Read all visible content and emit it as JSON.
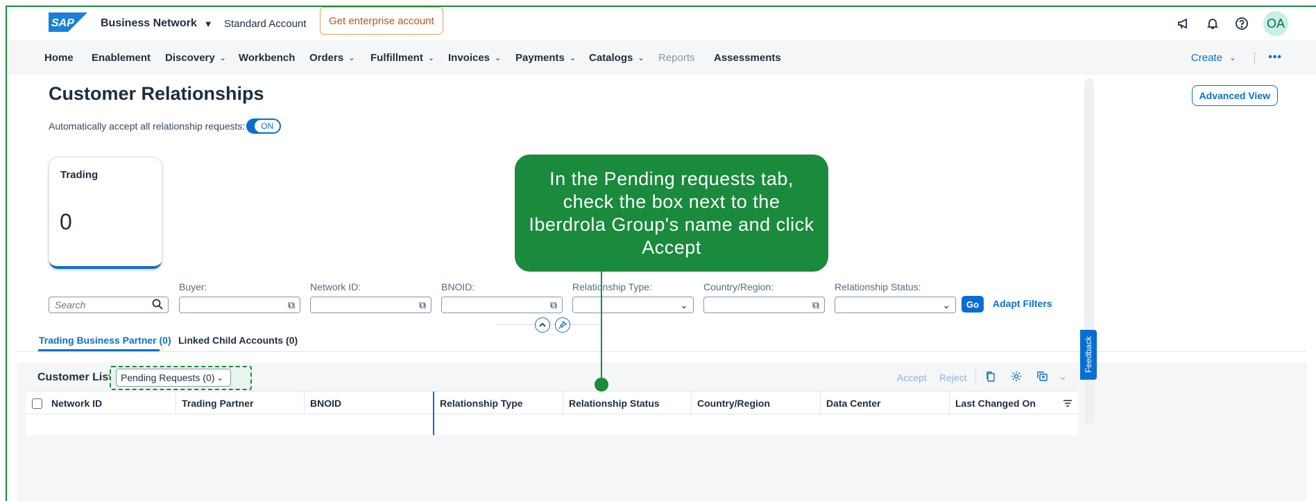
{
  "shell": {
    "brand": "SAP",
    "product": "Business Network",
    "account_type": "Standard Account",
    "enterprise_button": "Get enterprise account",
    "avatar_initials": "OA"
  },
  "nav": {
    "items": [
      {
        "label": "Home"
      },
      {
        "label": "Enablement"
      },
      {
        "label": "Discovery"
      },
      {
        "label": "Workbench"
      },
      {
        "label": "Orders"
      },
      {
        "label": "Fulfillment"
      },
      {
        "label": "Invoices"
      },
      {
        "label": "Payments"
      },
      {
        "label": "Catalogs"
      },
      {
        "label": "Reports"
      },
      {
        "label": "Assessments"
      }
    ],
    "create_label": "Create",
    "more_label": "•••"
  },
  "page": {
    "title": "Customer Relationships",
    "advanced_view": "Advanced View",
    "auto_accept_label": "Automatically accept all relationship requests:",
    "toggle_state": "ON"
  },
  "tile": {
    "title": "Trading",
    "value": "0"
  },
  "filters": {
    "search_placeholder": "Search",
    "buyer_label": "Buyer:",
    "network_id_label": "Network ID:",
    "bnoid_label": "BNOID:",
    "relationship_type_label": "Relationship Type:",
    "country_label": "Country/Region:",
    "relationship_status_label": "Relationship Status:",
    "go_label": "Go",
    "adapt_label": "Adapt Filters"
  },
  "tabs": {
    "trading": "Trading Business Partner (0)",
    "linked": "Linked Child Accounts (0)"
  },
  "table": {
    "title": "Customer List",
    "variant": "Pending Requests (0)",
    "accept": "Accept",
    "reject": "Reject",
    "columns": [
      "Network ID",
      "Trading Partner",
      "BNOID",
      "Relationship Type",
      "Relationship Status",
      "Country/Region",
      "Data Center",
      "Last Changed On"
    ]
  },
  "feedback_label": "Feedback",
  "callout": {
    "text": "In the Pending requests tab, check the box next to the Iberdrola Group's name and click Accept"
  },
  "colors": {
    "accent": "#0a6ed1",
    "callout": "#1a8a3c",
    "enterprise_border": "#e0a45d"
  }
}
